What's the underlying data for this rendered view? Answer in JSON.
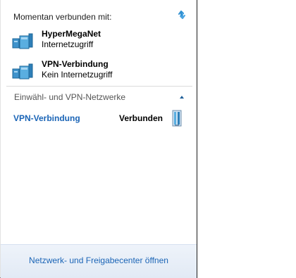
{
  "header": {
    "title": "Momentan verbunden mit:",
    "refresh_icon": "refresh-arrows-icon"
  },
  "connections": [
    {
      "name": "HyperMegaNet",
      "status": "Internetzugriff",
      "icon": "network-computer-icon"
    },
    {
      "name": "VPN-Verbindung",
      "status": "Kein Internetzugriff",
      "icon": "network-computer-icon"
    }
  ],
  "dialup_section": {
    "title": "Einwähl- und VPN-Netzwerke",
    "collapse_icon": "chevron-up-icon",
    "items": [
      {
        "name": "VPN-Verbindung",
        "status": "Verbunden",
        "icon": "vpn-connection-icon"
      }
    ]
  },
  "footer": {
    "link": "Netzwerk- und Freigabecenter öffnen"
  },
  "colors": {
    "link": "#1a64b6",
    "accent_blue": "#2f8fd0",
    "footer_bg": "#e8eef7"
  }
}
